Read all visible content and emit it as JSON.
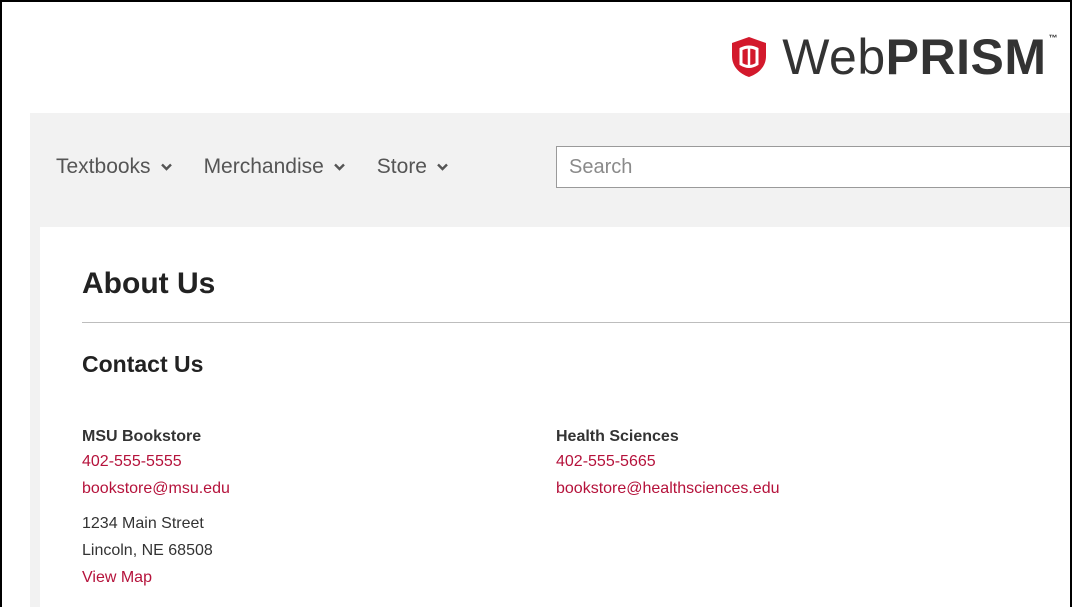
{
  "header": {
    "logo": {
      "brand_regular": "Web",
      "brand_bold": "PRISM",
      "trademark": "™",
      "brand_color": "#d3192c"
    }
  },
  "nav": {
    "items": [
      {
        "label": "Textbooks",
        "icon": "chevron-down-icon"
      },
      {
        "label": "Merchandise",
        "icon": "chevron-down-icon"
      },
      {
        "label": "Store",
        "icon": "chevron-down-icon"
      }
    ],
    "search": {
      "placeholder": "Search",
      "value": ""
    }
  },
  "main": {
    "title": "About Us",
    "section_title": "Contact Us",
    "contacts": [
      {
        "name": "MSU Bookstore",
        "phone": "402-555-5555",
        "email": "bookstore@msu.edu",
        "address_line1": "1234 Main Street",
        "address_line2": "Lincoln, NE 68508",
        "map_link": "View Map"
      },
      {
        "name": "Health Sciences",
        "phone": "402-555-5665",
        "email": "bookstore@healthsciences.edu"
      }
    ]
  },
  "colors": {
    "accent_red": "#b5123b",
    "nav_background": "#f2f2f2",
    "text_dark": "#222222"
  }
}
